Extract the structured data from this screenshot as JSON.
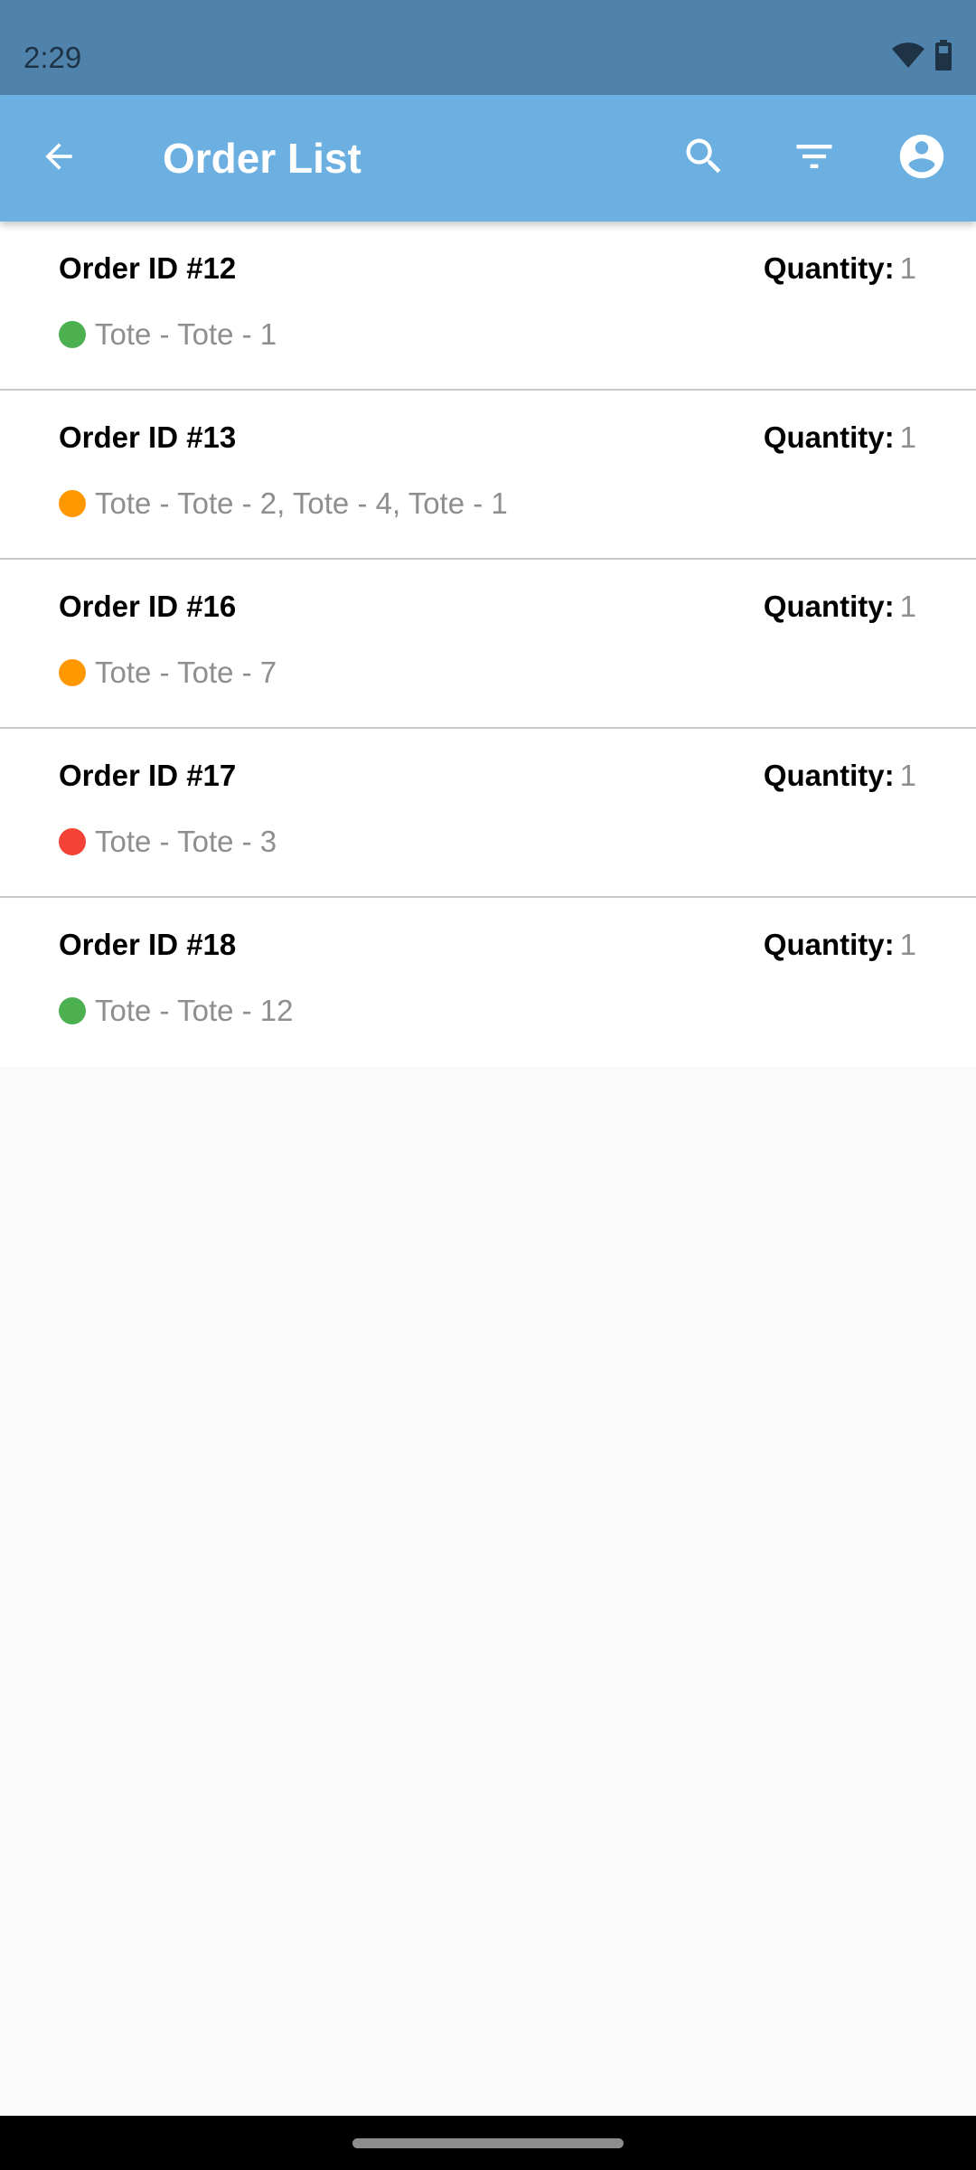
{
  "status_bar": {
    "time": "2:29",
    "icons": [
      "wifi-icon",
      "battery-icon"
    ]
  },
  "app_bar": {
    "title": "Order List",
    "back_icon": "arrow-back-icon",
    "actions": [
      {
        "name": "search",
        "icon": "search-icon"
      },
      {
        "name": "filter",
        "icon": "filter-icon"
      },
      {
        "name": "account",
        "icon": "account-circle-icon"
      }
    ]
  },
  "colors": {
    "status_bar": "#5083AC",
    "app_bar": "#6CB0E2",
    "status_green": "#4CAF50",
    "status_orange": "#FF9800",
    "status_red": "#F44336"
  },
  "orders": [
    {
      "order_id": "Order ID #12",
      "quantity_label": "Quantity:",
      "quantity_value": "1",
      "totes": "Tote - Tote - 1",
      "status_color": "#4CAF50"
    },
    {
      "order_id": "Order ID #13",
      "quantity_label": "Quantity:",
      "quantity_value": "1",
      "totes": "Tote - Tote - 2, Tote - 4, Tote - 1",
      "status_color": "#FF9800"
    },
    {
      "order_id": "Order ID #16",
      "quantity_label": "Quantity:",
      "quantity_value": "1",
      "totes": "Tote - Tote - 7",
      "status_color": "#FF9800"
    },
    {
      "order_id": "Order ID #17",
      "quantity_label": "Quantity:",
      "quantity_value": "1",
      "totes": "Tote - Tote - 3",
      "status_color": "#F44336"
    },
    {
      "order_id": "Order ID #18",
      "quantity_label": "Quantity:",
      "quantity_value": "1",
      "totes": "Tote - Tote - 12",
      "status_color": "#4CAF50"
    }
  ]
}
